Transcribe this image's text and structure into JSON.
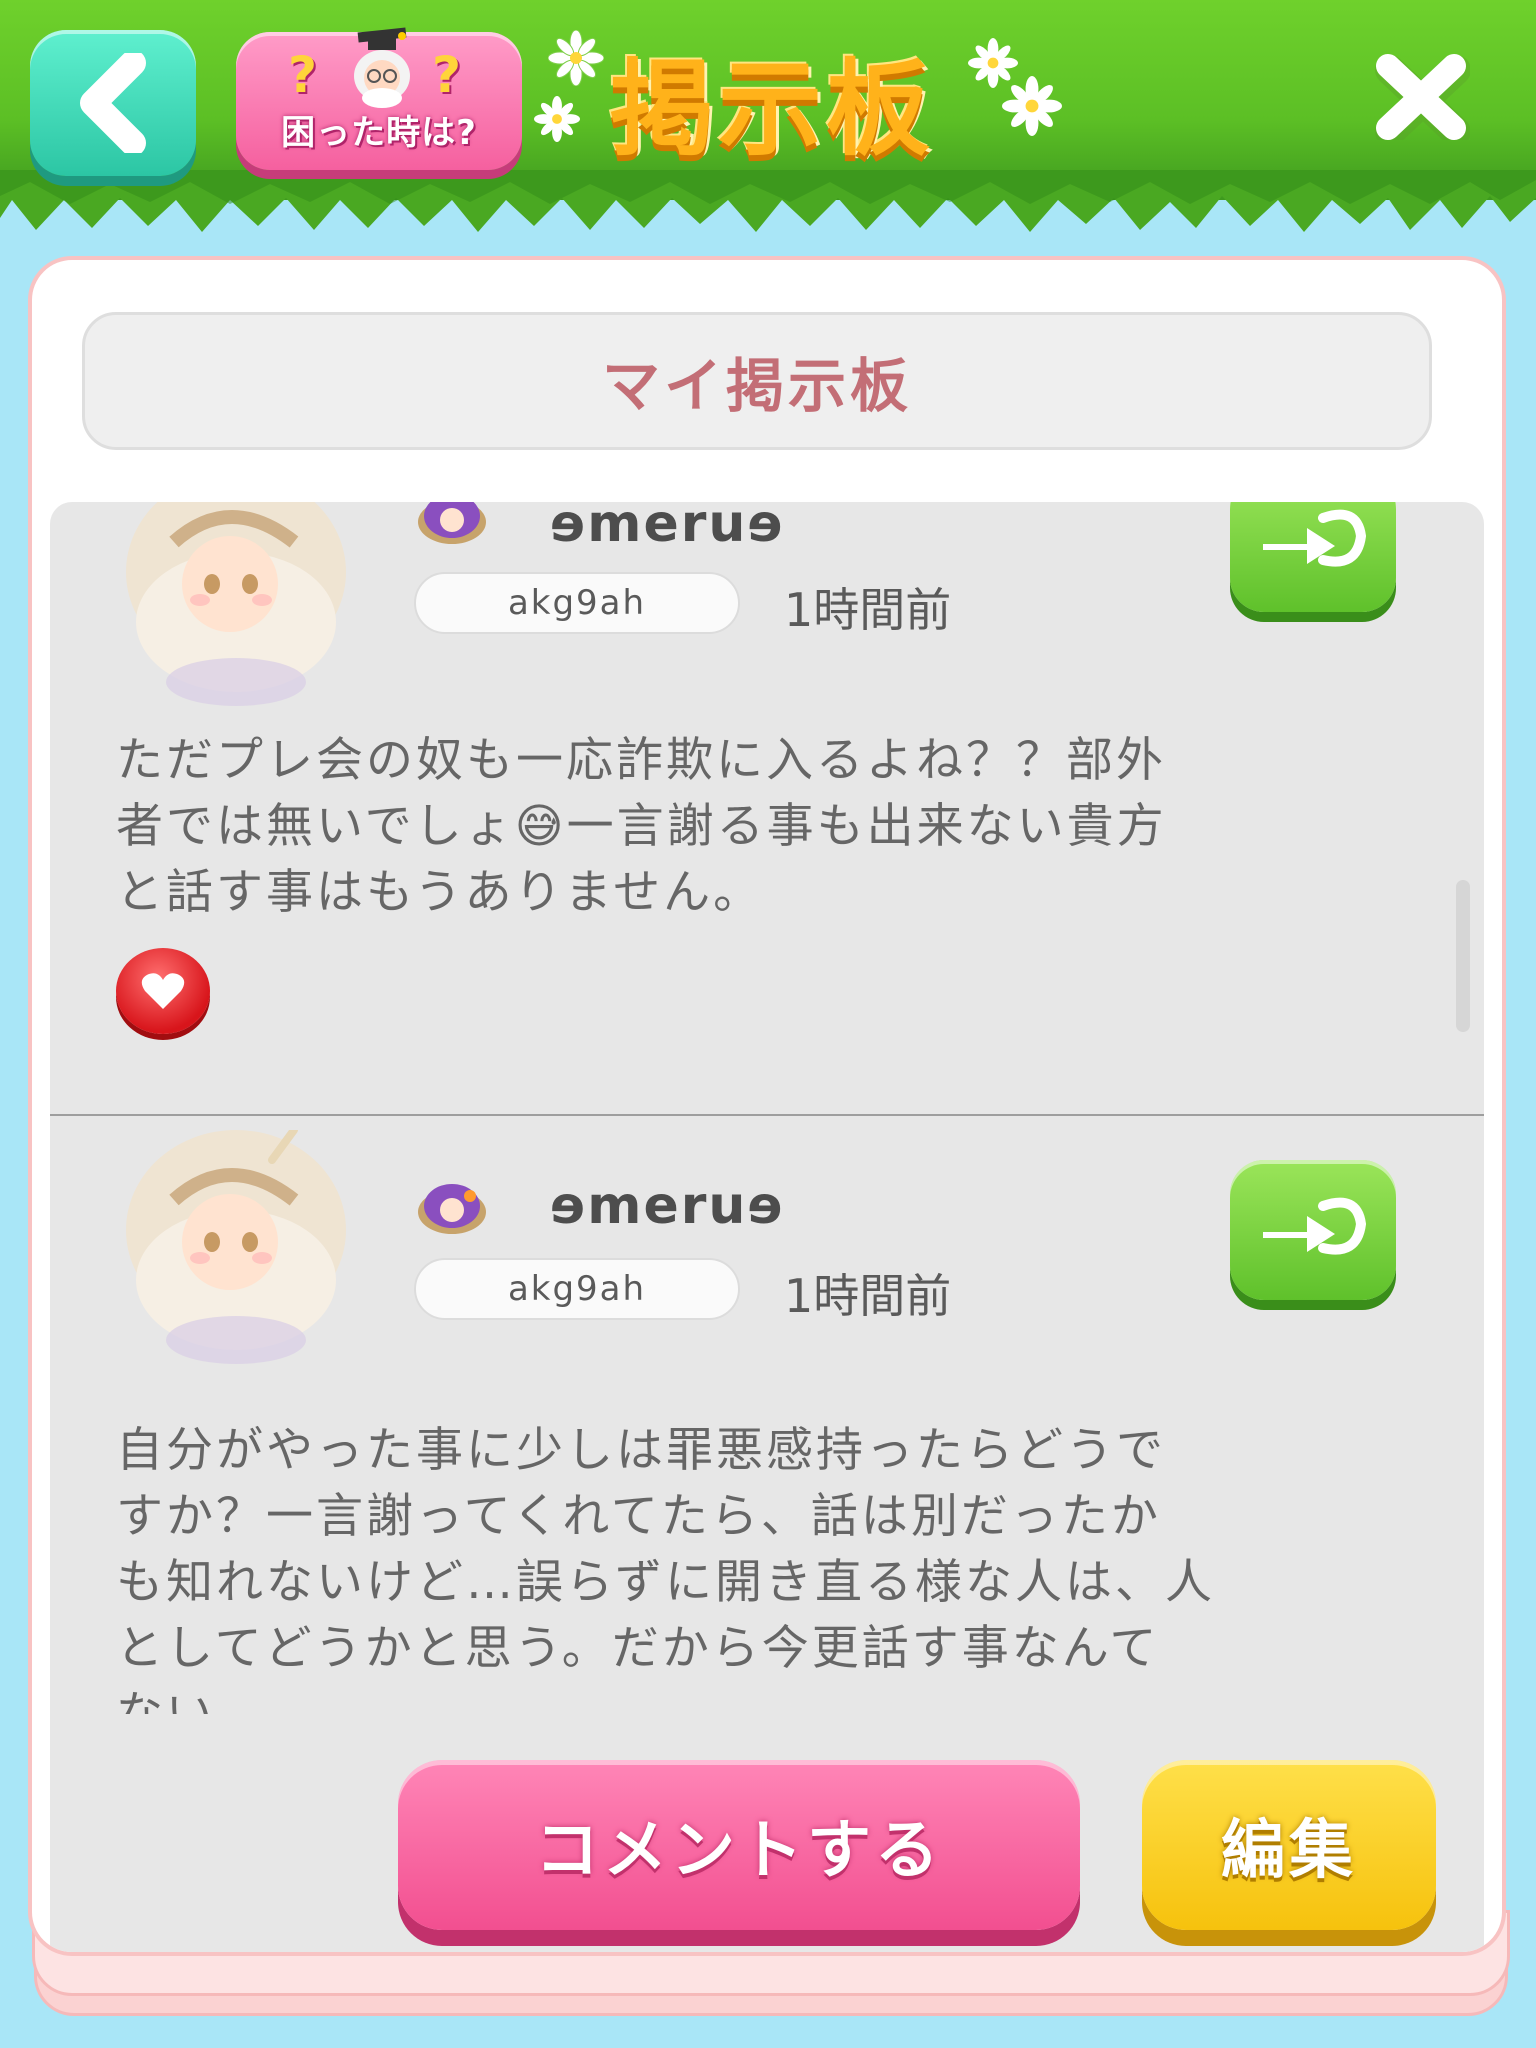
{
  "header": {
    "title": "掲示板",
    "help_label": "困った時は?",
    "help_q_left": "?",
    "help_q_right": "?"
  },
  "board": {
    "title": "マイ掲示板"
  },
  "posts": [
    {
      "username": "ɘmeruɘ",
      "user_id": "akg9ah",
      "time": "1時間前",
      "text": "ただプレ会の奴も一応詐欺に入るよね？？部外\n者では無いでしょ😅一言謝る事も出来ない貴方\nと話す事はもうありません。"
    },
    {
      "username": "ɘmeruɘ",
      "user_id": "akg9ah",
      "time": "1時間前",
      "text": "自分がやった事に少しは罪悪感持ったらどうで\nすか？一言謝ってくれてたら、話は別だったか\nも知れないけど…誤らずに開き直る様な人は、人\nとしてどうかと思う。だから今更話す事なんて\nない。"
    }
  ],
  "actions": {
    "comment_label": "コメントする",
    "edit_label": "編集"
  },
  "colors": {
    "background": "#a9e6f7",
    "grass": "#5cbf25",
    "title_orange": "#ffb21a",
    "board_title": "#c36e76",
    "comment_pink": "#f24f90",
    "edit_yellow": "#f6c20d",
    "follow_green": "#5fc12b",
    "like_red": "#d8151b"
  },
  "icons": {
    "back": "chevron-left-icon",
    "close": "close-icon",
    "follow": "follow-arrow-icon",
    "like": "heart-icon",
    "badge": "avatar-badge-icon"
  }
}
